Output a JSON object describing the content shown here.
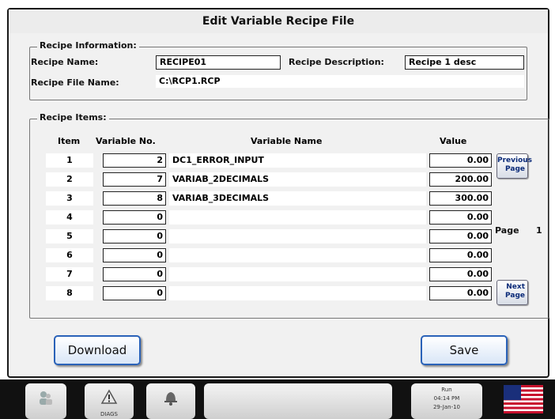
{
  "window": {
    "title": "Edit Variable Recipe File"
  },
  "recipe_info": {
    "legend": "Recipe Information:",
    "name_label": "Recipe Name:",
    "name_value": "RECIPE01",
    "description_label": "Recipe Description:",
    "description_value": "Recipe 1 desc",
    "file_label": "Recipe File Name:",
    "file_value": "C:\\RCP1.RCP"
  },
  "recipe_items": {
    "legend": "Recipe Items:",
    "headers": {
      "item": "Item",
      "variable_no": "Variable No.",
      "variable_name": "Variable Name",
      "value": "Value"
    },
    "rows": [
      {
        "item": "1",
        "variable_no": "2",
        "variable_name": "DC1_ERROR_INPUT",
        "value": "0.00"
      },
      {
        "item": "2",
        "variable_no": "7",
        "variable_name": "VARIAB_2DECIMALS",
        "value": "200.00"
      },
      {
        "item": "3",
        "variable_no": "8",
        "variable_name": "VARIAB_3DECIMALS",
        "value": "300.00"
      },
      {
        "item": "4",
        "variable_no": "0",
        "variable_name": "",
        "value": "0.00"
      },
      {
        "item": "5",
        "variable_no": "0",
        "variable_name": "",
        "value": "0.00"
      },
      {
        "item": "6",
        "variable_no": "0",
        "variable_name": "",
        "value": "0.00"
      },
      {
        "item": "7",
        "variable_no": "0",
        "variable_name": "",
        "value": "0.00"
      },
      {
        "item": "8",
        "variable_no": "0",
        "variable_name": "",
        "value": "0.00"
      }
    ]
  },
  "paging": {
    "previous_line1": "Previous",
    "previous_line2": "Page",
    "page_label": "Page",
    "page_number": "1",
    "next_line1": "Next",
    "next_line2": "Page"
  },
  "actions": {
    "download_label": "Download",
    "save_label": "Save"
  },
  "taskbar": {
    "diags_label": "DIAGS",
    "status_line1": "Run",
    "status_line2": "04:14 PM",
    "status_line3": "29-Jan-10"
  },
  "colors": {
    "accent_border": "#2a62b8",
    "button_text": "#0a2a78",
    "frame": "#f1f1f1"
  },
  "icons": [
    "users-icon",
    "diags-icon",
    "alarm-bell-icon",
    "us-flag-icon"
  ]
}
